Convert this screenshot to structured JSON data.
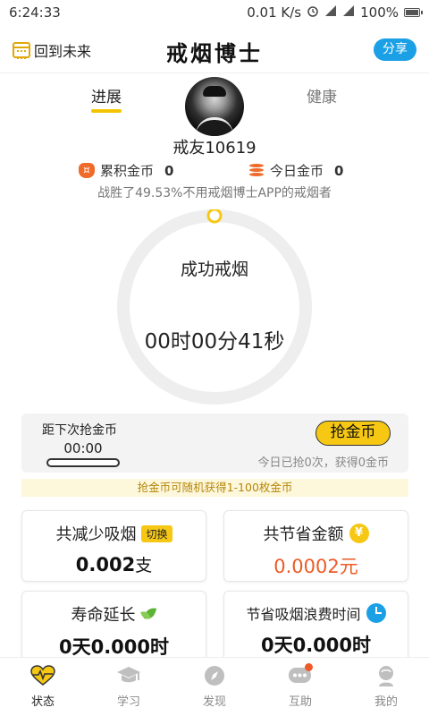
{
  "statusbar": {
    "time": "6:24:33",
    "network_speed": "0.01 K/s",
    "battery": "100%"
  },
  "appbar": {
    "back_future": "回到未来",
    "title": "戒烟博士",
    "share": "分享"
  },
  "tabs": {
    "progress": "进展",
    "health": "健康"
  },
  "profile": {
    "nickname": "戒友10619",
    "total_coins_label": "累积金币",
    "total_coins": "0",
    "today_coins_label": "今日金币",
    "today_coins": "0",
    "defeat_text": "战胜了49.53%不用戒烟博士APP的戒烟者"
  },
  "ring": {
    "label": "成功戒烟",
    "elapsed": "00时00分41秒",
    "progress_fraction": 0.0
  },
  "grab": {
    "next_label": "距下次抢金币",
    "countdown": "00:00",
    "button": "抢金币",
    "status": "今日已抢0次，获得0金币",
    "tip": "抢金币可随机获得1-100枚金币"
  },
  "stats": {
    "reduced_title": "共减少吸烟",
    "switch_label": "切换",
    "reduced_value": "0.002",
    "reduced_unit": "支",
    "saved_title": "共节省金额",
    "saved_value": "0.0002元",
    "life_title": "寿命延长",
    "life_value": "0天0.000时",
    "time_title": "节省吸烟浪费时间",
    "time_value": "0天0.000时"
  },
  "nav": {
    "items": [
      {
        "label": "状态",
        "icon": "heart-pulse-icon",
        "active": true
      },
      {
        "label": "学习",
        "icon": "graduation-cap-icon",
        "active": false
      },
      {
        "label": "发现",
        "icon": "compass-icon",
        "active": false
      },
      {
        "label": "互助",
        "icon": "chat-bubble-icon",
        "active": false
      },
      {
        "label": "我的",
        "icon": "user-icon",
        "active": false
      }
    ]
  },
  "colors": {
    "accent_yellow": "#f6c814",
    "share_blue": "#1ba0e6",
    "coin_orange": "#f06a2a",
    "money_orange": "#ec5b26"
  }
}
